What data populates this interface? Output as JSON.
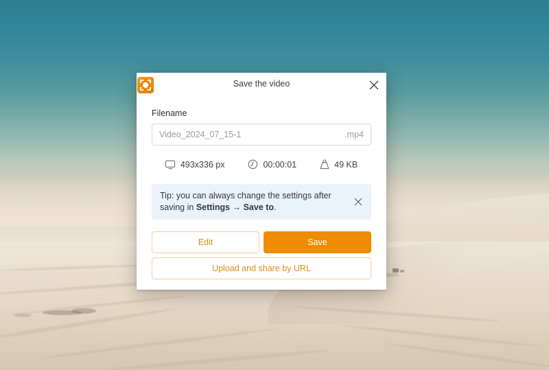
{
  "desktop": {
    "wallpaper_name": "desert-dunes-wallpaper",
    "sky_color": "#33859a",
    "sand_color": "#e7dccb"
  },
  "dialog": {
    "app_icon": "app-logo-icon",
    "title": "Save the video",
    "close_label": "close-dialog",
    "filename": {
      "label": "Filename",
      "value": "Video_2024_07_15-1",
      "placeholder": "Video_2024_07_15-1",
      "extension": ".mp4"
    },
    "meta": [
      {
        "icon": "monitor-icon",
        "text": "493x336 px"
      },
      {
        "icon": "clock-icon",
        "text": "00:00:01"
      },
      {
        "icon": "weight-icon",
        "text": "49 KB"
      }
    ],
    "tip": {
      "prefix": "Tip: you can always change the settings after saving in ",
      "bold1": "Settings",
      "arrow": " → ",
      "bold2": "Save to",
      "suffix": ".",
      "close_label": "dismiss-tip",
      "background": "#eaf3fb"
    },
    "buttons": {
      "edit": "Edit",
      "save": "Save",
      "upload": "Upload and share by URL"
    },
    "accent_color": "#ee8c04",
    "accent_border_color": "#f4cea2"
  }
}
